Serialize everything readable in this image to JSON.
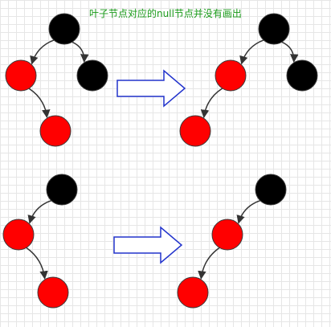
{
  "caption": "叶子节点对应的null节点并没有画出",
  "colors": {
    "red": "#ff0000",
    "black": "#000000",
    "node_stroke": "#3a3a3a",
    "edge": "#333333",
    "arrow_stroke": "#2233cc",
    "caption": "#1a9b1a"
  },
  "diagrams": [
    {
      "name": "top-left",
      "nodes": [
        {
          "id": "root",
          "color": "black"
        },
        {
          "id": "left",
          "color": "red"
        },
        {
          "id": "right",
          "color": "black"
        },
        {
          "id": "left-right",
          "color": "red"
        }
      ],
      "edges": [
        [
          "root",
          "left"
        ],
        [
          "root",
          "right"
        ],
        [
          "left",
          "left-right"
        ]
      ]
    },
    {
      "name": "top-right",
      "nodes": [
        {
          "id": "root",
          "color": "black"
        },
        {
          "id": "left",
          "color": "red"
        },
        {
          "id": "right",
          "color": "black"
        },
        {
          "id": "left-left",
          "color": "red"
        }
      ],
      "edges": [
        [
          "root",
          "left"
        ],
        [
          "root",
          "right"
        ],
        [
          "left",
          "left-left"
        ]
      ]
    },
    {
      "name": "bottom-left",
      "nodes": [
        {
          "id": "root",
          "color": "black"
        },
        {
          "id": "left",
          "color": "red"
        },
        {
          "id": "left-right",
          "color": "red"
        }
      ],
      "edges": [
        [
          "root",
          "left"
        ],
        [
          "left",
          "left-right"
        ]
      ]
    },
    {
      "name": "bottom-right",
      "nodes": [
        {
          "id": "root",
          "color": "black"
        },
        {
          "id": "left",
          "color": "red"
        },
        {
          "id": "left-left",
          "color": "red"
        }
      ],
      "edges": [
        [
          "root",
          "left"
        ],
        [
          "left",
          "left-left"
        ]
      ]
    }
  ],
  "transforms": [
    {
      "from": "top-left",
      "to": "top-right",
      "icon": "right-arrow-icon"
    },
    {
      "from": "bottom-left",
      "to": "bottom-right",
      "icon": "right-arrow-icon"
    }
  ]
}
